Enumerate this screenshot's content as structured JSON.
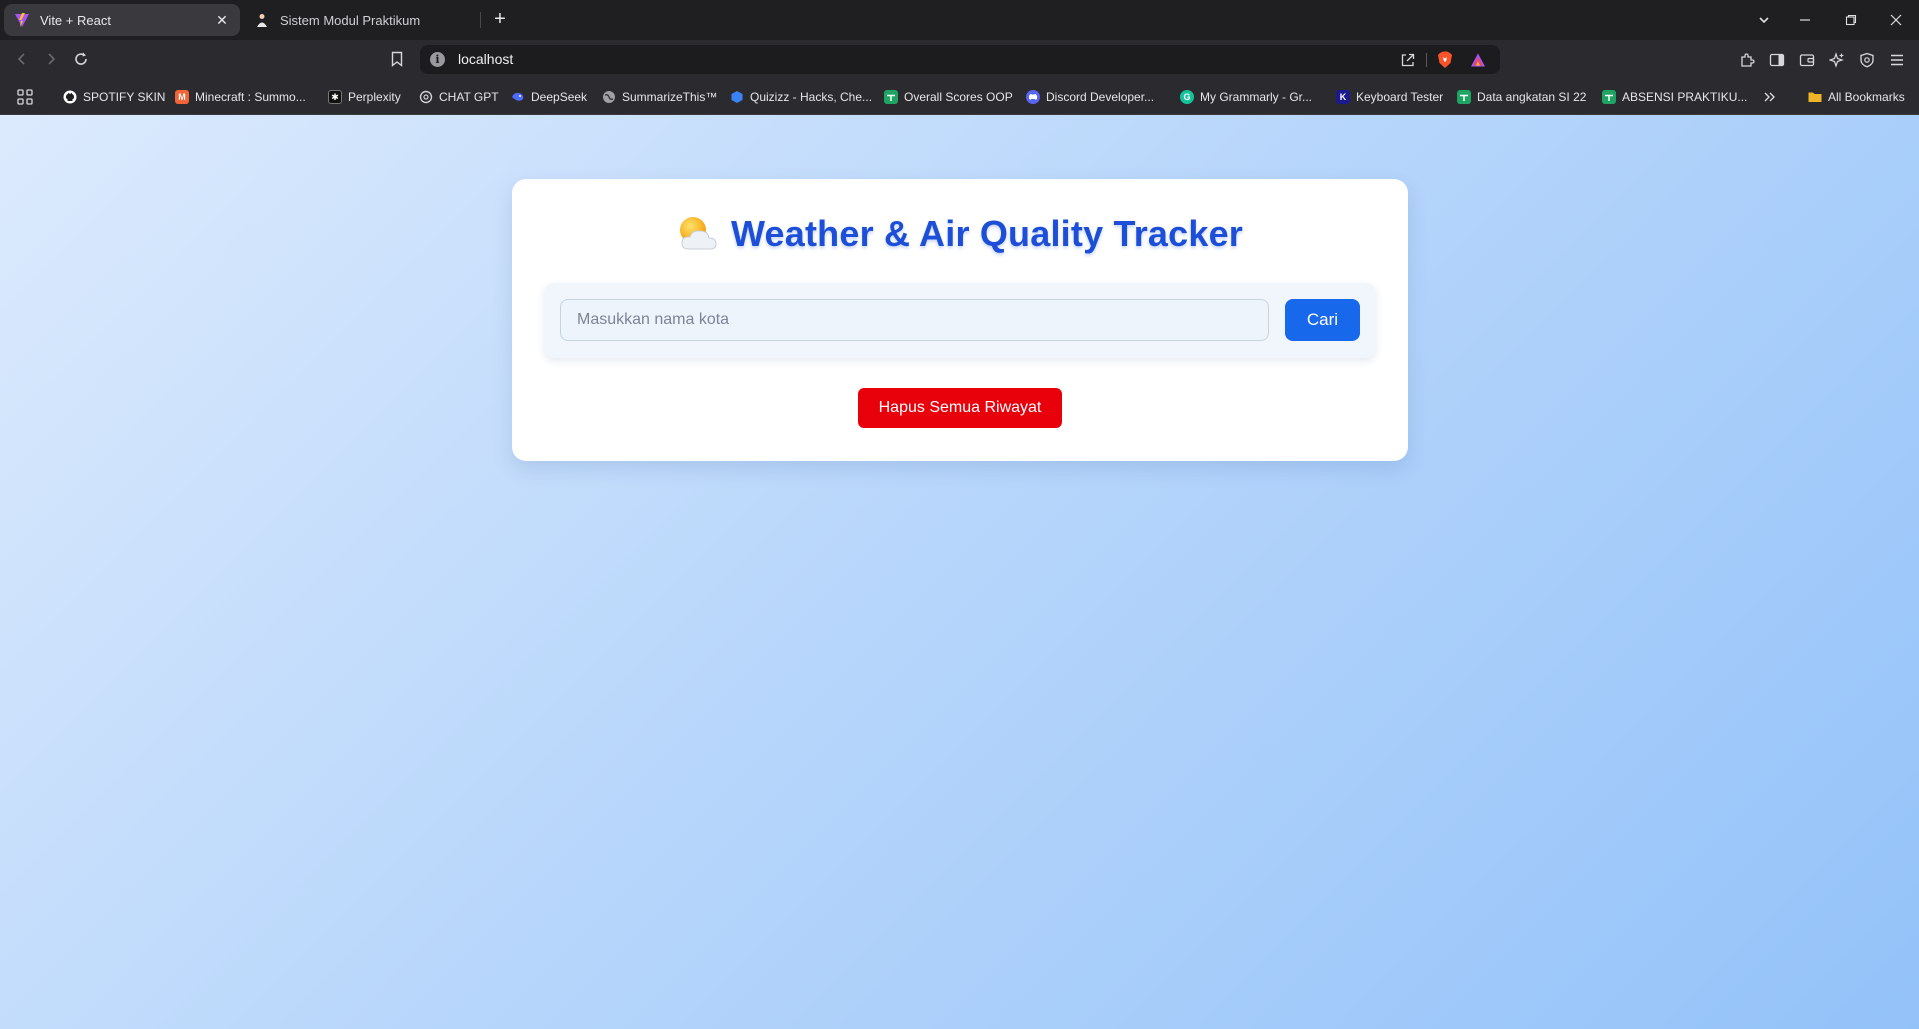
{
  "browser": {
    "tabs": [
      {
        "title": "Vite + React",
        "favicon": "vite-icon",
        "active": true
      },
      {
        "title": "Sistem Modul Praktikum",
        "favicon": "person-icon",
        "active": false
      }
    ],
    "address": "localhost",
    "bookmarks": [
      {
        "label": "SPOTIFY SKIN",
        "icon": "github-icon",
        "color": "#ffffff"
      },
      {
        "label": "Minecraft : Summo...",
        "icon": "curseforge-icon",
        "color": "#f16436"
      },
      {
        "label": "Perplexity",
        "icon": "perplexity-icon",
        "color": "#1f1f22"
      },
      {
        "label": "CHAT GPT",
        "icon": "openai-icon",
        "color": "#d0d0d0"
      },
      {
        "label": "DeepSeek",
        "icon": "deepseek-icon",
        "color": "#4d6bfe"
      },
      {
        "label": "SummarizeThis™",
        "icon": "globe-icon",
        "color": "#a0a0a4"
      },
      {
        "label": "Quizizz - Hacks, Che...",
        "icon": "shield-icon",
        "color": "#3b82f6"
      },
      {
        "label": "Overall Scores OOP",
        "icon": "sheets-icon",
        "color": "#1fa463"
      },
      {
        "label": "Discord Developer...",
        "icon": "discord-icon",
        "color": "#5865f2"
      },
      {
        "label": "My Grammarly - Gr...",
        "icon": "grammarly-icon",
        "color": "#15c39a"
      },
      {
        "label": "Keyboard Tester",
        "icon": "keyboard-icon",
        "color": "#1a1a8c"
      },
      {
        "label": "Data angkatan SI 22",
        "icon": "sheets-icon",
        "color": "#1fa463"
      },
      {
        "label": "ABSENSI PRAKTIKU...",
        "icon": "sheets-icon",
        "color": "#1fa463"
      }
    ],
    "all_bookmarks": "All Bookmarks"
  },
  "app": {
    "title": "Weather & Air Quality Tracker",
    "title_icon": "sun-behind-cloud-icon",
    "search": {
      "placeholder": "Masukkan nama kota",
      "value": "",
      "button_label": "Cari"
    },
    "clear_button_label": "Hapus Semua Riwayat",
    "colors": {
      "title": "#1d4ed8",
      "search_button": "#1868ec",
      "clear_button": "#e8000b"
    }
  }
}
